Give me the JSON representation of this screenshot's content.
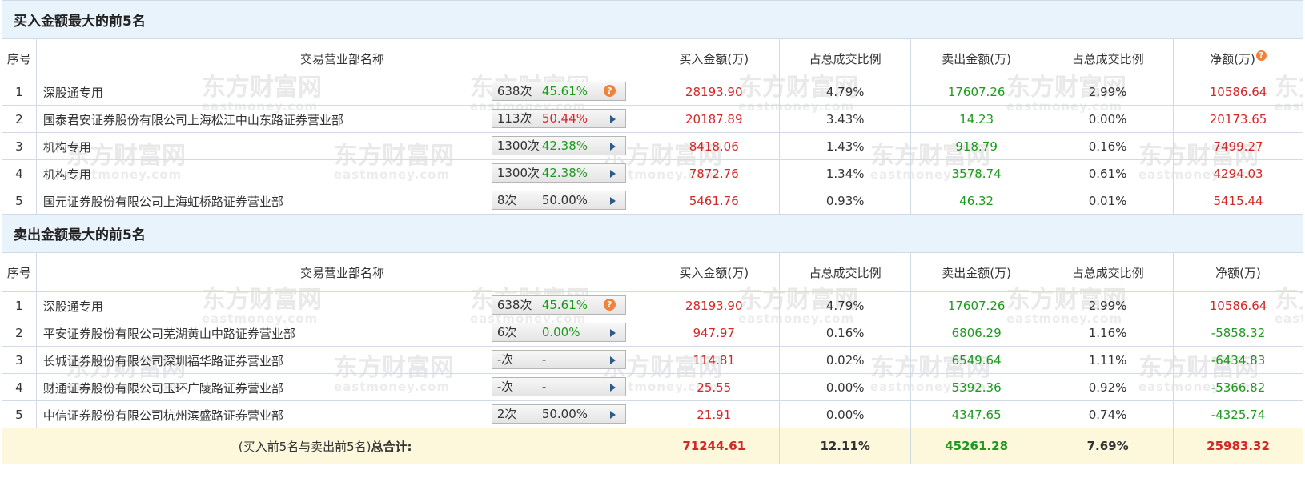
{
  "buy_section": {
    "title": "买入金额最大的前5名",
    "headers": [
      "序号",
      "交易营业部名称",
      "买入金额(万)",
      "占总成交比例",
      "卖出金额(万)",
      "占总成交比例",
      "净额(万)"
    ],
    "rows": [
      {
        "idx": "1",
        "name": "深股通专用",
        "count": "638次",
        "pct": "45.61%",
        "pct_color": "green",
        "badge_icon": "question",
        "buy": "28193.90",
        "buy_ratio": "4.79%",
        "sell": "17607.26",
        "sell_ratio": "2.99%",
        "net": "10586.64",
        "net_color": "red"
      },
      {
        "idx": "2",
        "name": "国泰君安证券股份有限公司上海松江中山东路证券营业部",
        "count": "113次",
        "pct": "50.44%",
        "pct_color": "red",
        "badge_icon": "arrow",
        "buy": "20187.89",
        "buy_ratio": "3.43%",
        "sell": "14.23",
        "sell_ratio": "0.00%",
        "net": "20173.65",
        "net_color": "red"
      },
      {
        "idx": "3",
        "name": "机构专用",
        "count": "1300次",
        "pct": "42.38%",
        "pct_color": "green",
        "badge_icon": "arrow",
        "buy": "8418.06",
        "buy_ratio": "1.43%",
        "sell": "918.79",
        "sell_ratio": "0.16%",
        "net": "7499.27",
        "net_color": "red"
      },
      {
        "idx": "4",
        "name": "机构专用",
        "count": "1300次",
        "pct": "42.38%",
        "pct_color": "green",
        "badge_icon": "arrow",
        "buy": "7872.76",
        "buy_ratio": "1.34%",
        "sell": "3578.74",
        "sell_ratio": "0.61%",
        "net": "4294.03",
        "net_color": "red"
      },
      {
        "idx": "5",
        "name": "国元证券股份有限公司上海虹桥路证券营业部",
        "count": "8次",
        "pct": "50.00%",
        "pct_color": "plain",
        "badge_icon": "arrow",
        "buy": "5461.76",
        "buy_ratio": "0.93%",
        "sell": "46.32",
        "sell_ratio": "0.01%",
        "net": "5415.44",
        "net_color": "red"
      }
    ]
  },
  "sell_section": {
    "title": "卖出金额最大的前5名",
    "headers": [
      "序号",
      "交易营业部名称",
      "买入金额(万)",
      "占总成交比例",
      "卖出金额(万)",
      "占总成交比例",
      "净额(万)"
    ],
    "rows": [
      {
        "idx": "1",
        "name": "深股通专用",
        "count": "638次",
        "pct": "45.61%",
        "pct_color": "green",
        "badge_icon": "question",
        "buy": "28193.90",
        "buy_ratio": "4.79%",
        "sell": "17607.26",
        "sell_ratio": "2.99%",
        "net": "10586.64",
        "net_color": "red"
      },
      {
        "idx": "2",
        "name": "平安证券股份有限公司芜湖黄山中路证券营业部",
        "count": "6次",
        "pct": "0.00%",
        "pct_color": "green",
        "badge_icon": "arrow",
        "buy": "947.97",
        "buy_ratio": "0.16%",
        "sell": "6806.29",
        "sell_ratio": "1.16%",
        "net": "-5858.32",
        "net_color": "green"
      },
      {
        "idx": "3",
        "name": "长城证券股份有限公司深圳福华路证券营业部",
        "count": "-次",
        "pct": "-",
        "pct_color": "plain",
        "badge_icon": "arrow",
        "buy": "114.81",
        "buy_ratio": "0.02%",
        "sell": "6549.64",
        "sell_ratio": "1.11%",
        "net": "-6434.83",
        "net_color": "green"
      },
      {
        "idx": "4",
        "name": "财通证券股份有限公司玉环广陵路证券营业部",
        "count": "-次",
        "pct": "-",
        "pct_color": "plain",
        "badge_icon": "arrow",
        "buy": "25.55",
        "buy_ratio": "0.00%",
        "sell": "5392.36",
        "sell_ratio": "0.92%",
        "net": "-5366.82",
        "net_color": "green"
      },
      {
        "idx": "5",
        "name": "中信证券股份有限公司杭州滨盛路证券营业部",
        "count": "2次",
        "pct": "50.00%",
        "pct_color": "plain",
        "badge_icon": "arrow",
        "buy": "21.91",
        "buy_ratio": "0.00%",
        "sell": "4347.65",
        "sell_ratio": "0.74%",
        "net": "-4325.74",
        "net_color": "green"
      }
    ]
  },
  "total": {
    "label_prefix": "(买入前5名与卖出前5名)",
    "label_suffix": "总合计:",
    "buy": "71244.61",
    "buy_ratio": "12.11%",
    "sell": "45261.28",
    "sell_ratio": "7.69%",
    "net": "25983.32"
  },
  "help_icon_glyph": "?",
  "watermark": {
    "cn": "东方财富网",
    "en": "eastmoney.com"
  },
  "colors": {
    "red": "#d32828",
    "green": "#1d9a1d",
    "header_bg": "#e9f3fb",
    "total_bg": "#fdf8dc",
    "border": "#cfdbe7",
    "help_icon": "#f0823c"
  }
}
